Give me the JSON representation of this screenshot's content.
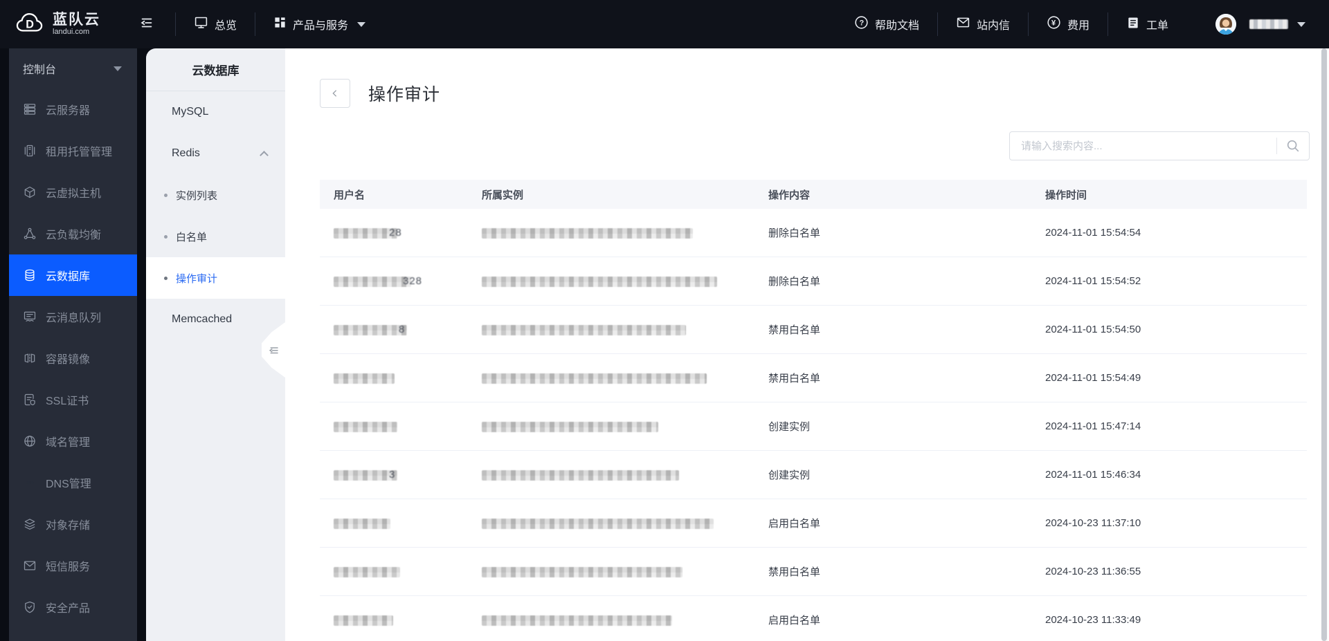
{
  "header": {
    "brand": {
      "name": "蓝队云",
      "domain": "landui.com"
    },
    "nav": [
      {
        "label": "总览",
        "icon": "monitor-icon"
      },
      {
        "label": "产品与服务",
        "icon": "grid-icon",
        "has_caret": true
      }
    ],
    "links": [
      {
        "label": "帮助文档",
        "icon": "help-icon"
      },
      {
        "label": "站内信",
        "icon": "mail-icon"
      },
      {
        "label": "费用",
        "icon": "fee-icon"
      },
      {
        "label": "工单",
        "icon": "ticket-icon"
      }
    ],
    "user": {
      "name_masked": true
    }
  },
  "sidebar": {
    "console_label": "控制台",
    "items": [
      {
        "label": "云服务器",
        "icon": "server-icon",
        "active": false
      },
      {
        "label": "租用托管管理",
        "icon": "hosting-icon",
        "active": false
      },
      {
        "label": "云虚拟主机",
        "icon": "cube-icon",
        "active": false
      },
      {
        "label": "云负载均衡",
        "icon": "load-balancer-icon",
        "active": false
      },
      {
        "label": "云数据库",
        "icon": "database-icon",
        "active": true
      },
      {
        "label": "云消息队列",
        "icon": "message-queue-icon",
        "active": false
      },
      {
        "label": "容器镜像",
        "icon": "container-image-icon",
        "active": false
      },
      {
        "label": "SSL证书",
        "icon": "ssl-cert-icon",
        "active": false
      },
      {
        "label": "域名管理",
        "icon": "globe-icon",
        "active": false
      },
      {
        "label": "DNS管理",
        "icon": "dns-icon",
        "active": false
      },
      {
        "label": "对象存储",
        "icon": "storage-layers-icon",
        "active": false
      },
      {
        "label": "短信服务",
        "icon": "sms-icon",
        "active": false
      },
      {
        "label": "安全产品",
        "icon": "shield-icon",
        "active": false
      }
    ]
  },
  "subsidebar": {
    "title": "云数据库",
    "items": [
      {
        "label": "MySQL",
        "type": "group"
      },
      {
        "label": "Redis",
        "type": "group",
        "expanded": true
      },
      {
        "label": "实例列表",
        "type": "sub",
        "active": false
      },
      {
        "label": "白名单",
        "type": "sub",
        "active": false
      },
      {
        "label": "操作审计",
        "type": "sub",
        "active": true
      },
      {
        "label": "Memcached",
        "type": "group"
      }
    ]
  },
  "main": {
    "page_title": "操作审计",
    "search_placeholder": "请输入搜索内容...",
    "table": {
      "columns": [
        "用户名",
        "所属实例",
        "操作内容",
        "操作时间"
      ],
      "rows": [
        {
          "username_masked": true,
          "username_masked_width": 92,
          "username_hint": "28",
          "instance_masked": true,
          "instance_masked_width": 305,
          "action": "删除白名单",
          "time": "2024-11-01 15:54:54"
        },
        {
          "username_masked": true,
          "username_masked_width": 112,
          "username_hint": "328",
          "instance_masked": true,
          "instance_masked_width": 340,
          "action": "删除白名单",
          "time": "2024-11-01 15:54:52"
        },
        {
          "username_masked": true,
          "username_masked_width": 106,
          "username_hint": "8",
          "instance_masked": true,
          "instance_masked_width": 295,
          "action": "禁用白名单",
          "time": "2024-11-01 15:54:50"
        },
        {
          "username_masked": true,
          "username_masked_width": 88,
          "username_hint": "",
          "instance_masked": true,
          "instance_masked_width": 325,
          "action": "禁用白名单",
          "time": "2024-11-01 15:54:49"
        },
        {
          "username_masked": true,
          "username_masked_width": 92,
          "username_hint": "",
          "instance_masked": true,
          "instance_masked_width": 255,
          "action": "创建实例",
          "time": "2024-11-01 15:47:14"
        },
        {
          "username_masked": true,
          "username_masked_width": 92,
          "username_hint": "3",
          "instance_masked": true,
          "instance_masked_width": 285,
          "action": "创建实例",
          "time": "2024-11-01 15:46:34"
        },
        {
          "username_masked": true,
          "username_masked_width": 82,
          "username_hint": "",
          "instance_masked": true,
          "instance_masked_width": 335,
          "action": "启用白名单",
          "time": "2024-10-23 11:37:10"
        },
        {
          "username_masked": true,
          "username_masked_width": 96,
          "username_hint": "",
          "instance_masked": true,
          "instance_masked_width": 290,
          "action": "禁用白名单",
          "time": "2024-10-23 11:36:55"
        },
        {
          "username_masked": true,
          "username_masked_width": 86,
          "username_hint": "",
          "instance_masked": true,
          "instance_masked_width": 275,
          "action": "启用白名单",
          "time": "2024-10-23 11:33:49"
        }
      ]
    }
  },
  "colors": {
    "topbar_bg": "#0f121a",
    "sidebar_bg": "#272c38",
    "sidebar_active_bg": "#0b5cff",
    "subsidebar_bg": "#eef0f4",
    "active_link_blue": "#2a6af2",
    "table_header_bg": "#f6f7fa"
  }
}
